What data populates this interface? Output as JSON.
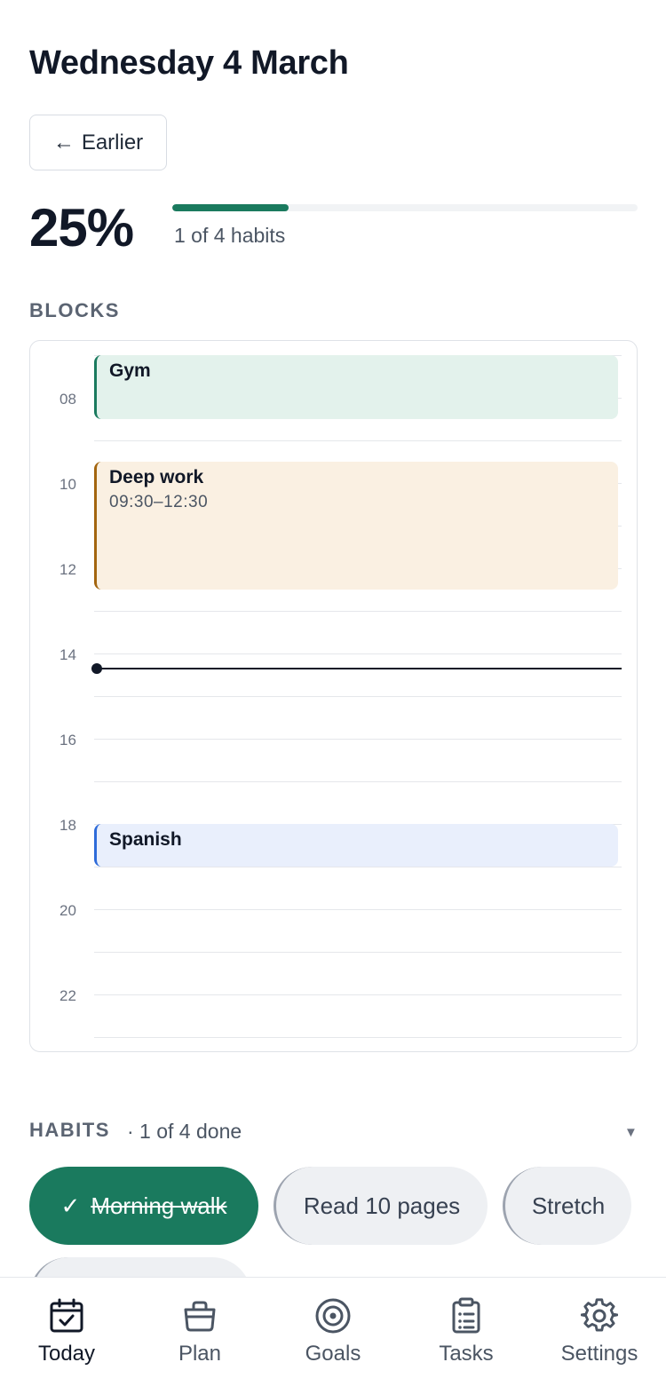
{
  "header": {
    "title": "Wednesday 4 March",
    "earlier_label": "Earlier"
  },
  "progress": {
    "percent_label": "25%",
    "fraction": 0.25,
    "summary": "1 of 4 habits"
  },
  "blocks_section": {
    "label": "BLOCKS",
    "hours": [
      "08",
      "10",
      "12",
      "14",
      "16",
      "18",
      "20",
      "22"
    ],
    "blocks": [
      {
        "title": "Gym",
        "time": "",
        "color": "#1a7a5e",
        "bg": "#e3f2ec"
      },
      {
        "title": "Deep work",
        "time": "09:30–12:30",
        "color": "#a3650f",
        "bg": "#faf0e2"
      },
      {
        "title": "Spanish",
        "time": "",
        "color": "#2e6bd9",
        "bg": "#e9effc"
      }
    ]
  },
  "habits_section": {
    "label": "HABITS",
    "count_label": "· 1 of 4 done",
    "habits": [
      {
        "label": "Morning walk",
        "done": true
      },
      {
        "label": "Read 10 pages",
        "done": false
      },
      {
        "label": "Stretch",
        "done": false
      }
    ]
  },
  "tabs": [
    {
      "label": "Today",
      "icon": "calendar-check-icon",
      "active": true
    },
    {
      "label": "Plan",
      "icon": "basket-icon",
      "active": false
    },
    {
      "label": "Goals",
      "icon": "target-icon",
      "active": false
    },
    {
      "label": "Tasks",
      "icon": "clipboard-list-icon",
      "active": false
    },
    {
      "label": "Settings",
      "icon": "gear-icon",
      "active": false
    }
  ],
  "colors": {
    "accent": "#1a7a5e",
    "text": "#111827",
    "muted": "#6b7280"
  }
}
